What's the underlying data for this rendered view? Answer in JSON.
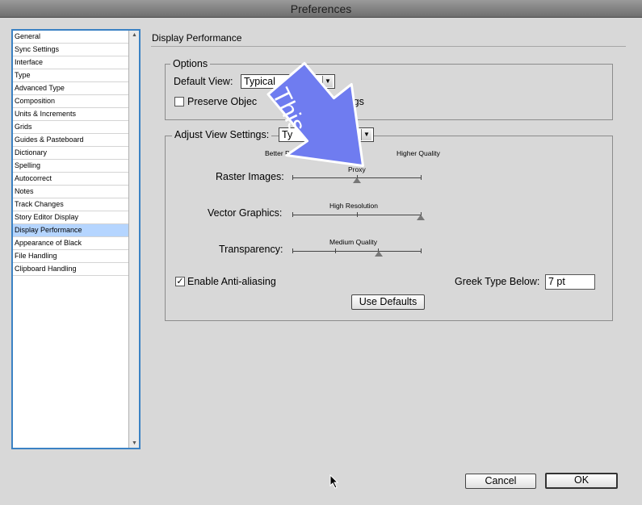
{
  "window": {
    "title": "Preferences"
  },
  "sidebar": {
    "items": [
      {
        "label": "General"
      },
      {
        "label": "Sync Settings"
      },
      {
        "label": "Interface"
      },
      {
        "label": "Type"
      },
      {
        "label": "Advanced Type"
      },
      {
        "label": "Composition"
      },
      {
        "label": "Units & Increments"
      },
      {
        "label": "Grids"
      },
      {
        "label": "Guides & Pasteboard"
      },
      {
        "label": "Dictionary"
      },
      {
        "label": "Spelling"
      },
      {
        "label": "Autocorrect"
      },
      {
        "label": "Notes"
      },
      {
        "label": "Track Changes"
      },
      {
        "label": "Story Editor Display"
      },
      {
        "label": "Display Performance"
      },
      {
        "label": "Appearance of Black"
      },
      {
        "label": "File Handling"
      },
      {
        "label": "Clipboard Handling"
      }
    ],
    "selected": "Display Performance"
  },
  "main": {
    "section_title": "Display Performance",
    "options": {
      "legend": "Options",
      "default_view_label": "Default View:",
      "default_view_value": "Typical",
      "preserve_label_start": "Preserve Objec",
      "preserve_label_end": "ttings",
      "preserve_checked": false
    },
    "adjust": {
      "legend": "Adjust View Settings:",
      "select_value": "Ty",
      "better_performance": "Better Perfo",
      "higher_quality": "Higher Quality",
      "raster": {
        "label": "Raster Images:",
        "value_text": "Proxy",
        "level": 0.5
      },
      "vector": {
        "label": "Vector Graphics:",
        "value_text": "High Resolution",
        "level": 1.0
      },
      "transparency": {
        "label": "Transparency:",
        "value_text": "Medium Quality",
        "level": 0.67
      },
      "anti_alias_label": "Enable Anti-aliasing",
      "anti_alias_checked": true,
      "greek_label": "Greek Type Below:",
      "greek_value": "7 pt",
      "use_defaults": "Use Defaults"
    }
  },
  "footer": {
    "cancel": "Cancel",
    "ok": "OK"
  },
  "callout": {
    "text": "This",
    "color": "#6f7cf0"
  },
  "check_mark": "✓",
  "select_arrow": "▼"
}
